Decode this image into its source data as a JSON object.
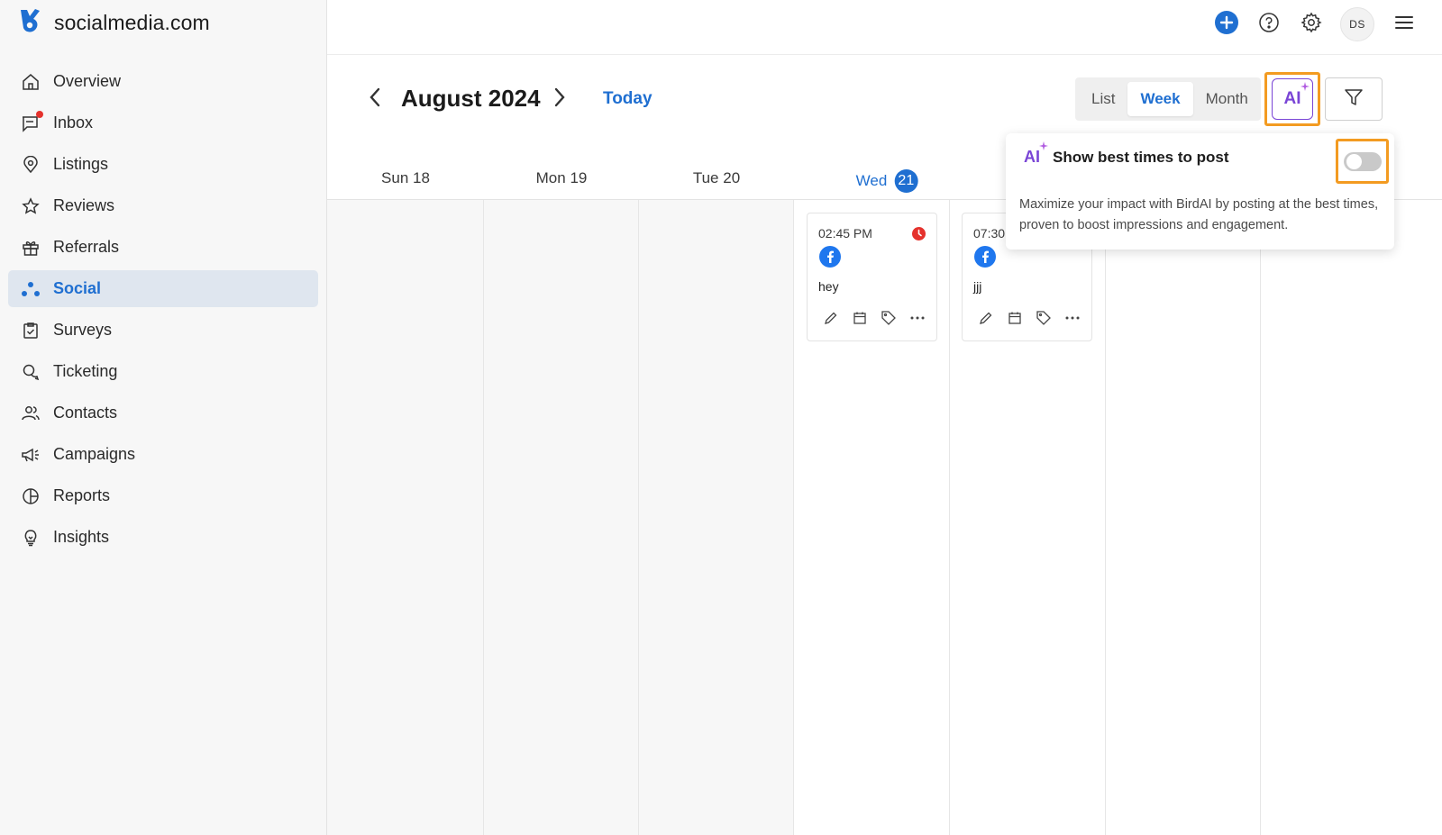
{
  "app": {
    "brand_name": "socialmedia.com"
  },
  "sidebar": {
    "items": [
      {
        "label": "Overview",
        "icon": "home-icon"
      },
      {
        "label": "Inbox",
        "icon": "inbox-icon",
        "has_badge": true
      },
      {
        "label": "Listings",
        "icon": "location-pin-icon"
      },
      {
        "label": "Reviews",
        "icon": "star-icon"
      },
      {
        "label": "Referrals",
        "icon": "gift-icon"
      },
      {
        "label": "Social",
        "icon": "social-dots-icon",
        "active": true
      },
      {
        "label": "Surveys",
        "icon": "clipboard-check-icon"
      },
      {
        "label": "Ticketing",
        "icon": "chat-bubbles-icon"
      },
      {
        "label": "Contacts",
        "icon": "people-icon"
      },
      {
        "label": "Campaigns",
        "icon": "megaphone-icon"
      },
      {
        "label": "Reports",
        "icon": "pie-chart-icon"
      },
      {
        "label": "Insights",
        "icon": "lightbulb-icon"
      }
    ]
  },
  "topbar": {
    "avatar_initials": "DS",
    "icons": [
      "plus-circle-icon",
      "help-icon",
      "gear-icon",
      "menu-icon"
    ]
  },
  "calendar": {
    "month_title": "August 2024",
    "today_label": "Today",
    "views": [
      {
        "label": "List",
        "active": false
      },
      {
        "label": "Week",
        "active": true
      },
      {
        "label": "Month",
        "active": false
      }
    ],
    "ai_button_label": "AI",
    "days": [
      {
        "label": "Sun 18"
      },
      {
        "label": "Mon 19"
      },
      {
        "label": "Tue 20"
      },
      {
        "label": "Wed",
        "num": "21",
        "today": true
      }
    ],
    "posts": [
      {
        "time": "02:45 PM",
        "text": "hey",
        "network": "facebook",
        "status": "error"
      },
      {
        "time": "07:30",
        "text": "jjj",
        "network": "facebook"
      }
    ]
  },
  "popover": {
    "icon_label": "AI",
    "title": "Show best times to post",
    "toggle_on": false,
    "body": "Maximize your impact with BirdAI by posting at the best times, proven to boost impressions and engagement."
  },
  "colors": {
    "accent": "#1f6fd1",
    "highlight": "#f39b21",
    "ai_purple": "#7a45d6",
    "error": "#e5322d",
    "facebook": "#1f77ee"
  }
}
